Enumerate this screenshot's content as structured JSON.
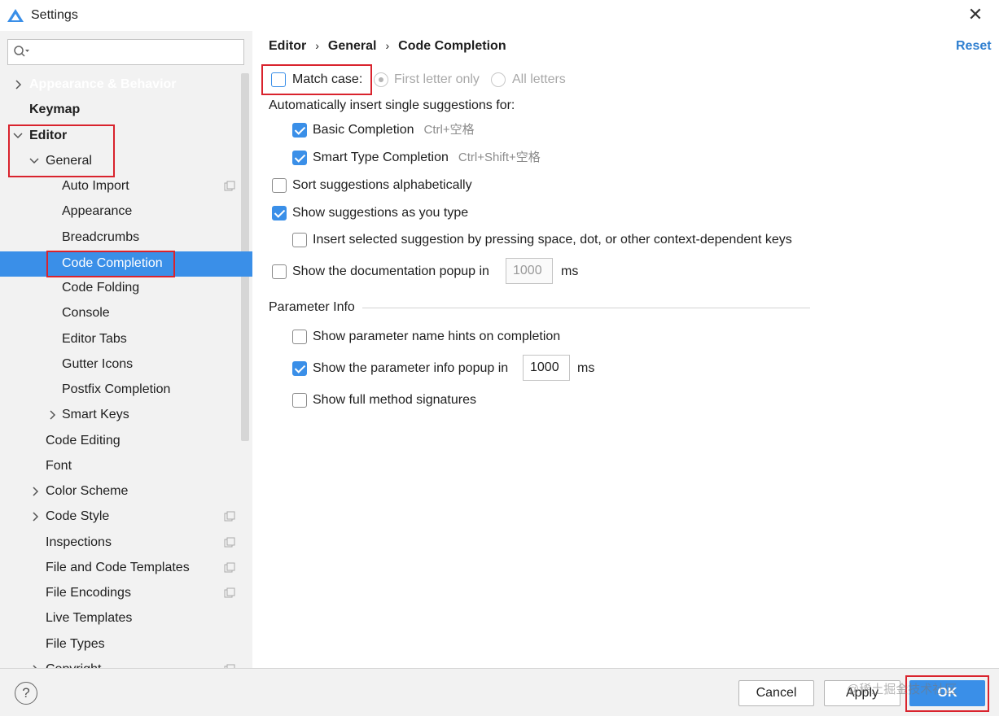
{
  "window": {
    "title": "Settings",
    "close_glyph": "✕"
  },
  "search": {
    "placeholder": "",
    "icon": "search-icon"
  },
  "sidebar": {
    "items": [
      {
        "label": "Appearance & Behavior"
      },
      {
        "label": "Keymap"
      },
      {
        "label": "Editor"
      },
      {
        "label": "General"
      },
      {
        "label": "Auto Import"
      },
      {
        "label": "Appearance"
      },
      {
        "label": "Breadcrumbs"
      },
      {
        "label": "Code Completion"
      },
      {
        "label": "Code Folding"
      },
      {
        "label": "Console"
      },
      {
        "label": "Editor Tabs"
      },
      {
        "label": "Gutter Icons"
      },
      {
        "label": "Postfix Completion"
      },
      {
        "label": "Smart Keys"
      },
      {
        "label": "Code Editing"
      },
      {
        "label": "Font"
      },
      {
        "label": "Color Scheme"
      },
      {
        "label": "Code Style"
      },
      {
        "label": "Inspections"
      },
      {
        "label": "File and Code Templates"
      },
      {
        "label": "File Encodings"
      },
      {
        "label": "Live Templates"
      },
      {
        "label": "File Types"
      },
      {
        "label": "Copyright"
      }
    ]
  },
  "breadcrumb": {
    "part1": "Editor",
    "part2": "General",
    "part3": "Code Completion",
    "sep": "›"
  },
  "reset_label": "Reset",
  "options": {
    "match_case": "Match case:",
    "first_letter_only": "First letter only",
    "all_letters": "All letters",
    "auto_insert_heading": "Automatically insert single suggestions for:",
    "basic_completion": "Basic Completion",
    "basic_shortcut": "Ctrl+空格",
    "smart_type_completion": "Smart Type Completion",
    "smart_shortcut": "Ctrl+Shift+空格",
    "sort_alpha": "Sort suggestions alphabetically",
    "show_as_type": "Show suggestions as you type",
    "insert_selected": "Insert selected suggestion by pressing space, dot, or other context-dependent keys",
    "show_doc_popup": "Show the documentation popup in",
    "doc_popup_value": "1000",
    "ms": "ms"
  },
  "parameter_info": {
    "heading": "Parameter Info",
    "name_hints": "Show parameter name hints on completion",
    "info_popup": "Show the parameter info popup in",
    "info_popup_value": "1000",
    "ms": "ms",
    "full_signatures": "Show full method signatures"
  },
  "footer": {
    "help": "?",
    "cancel": "Cancel",
    "apply": "Apply",
    "ok": "OK",
    "watermark": "@稀土掘金技术社区"
  },
  "colors": {
    "accent": "#3a8fe8",
    "highlight_border": "#d9232d",
    "link": "#2f7fd0"
  }
}
